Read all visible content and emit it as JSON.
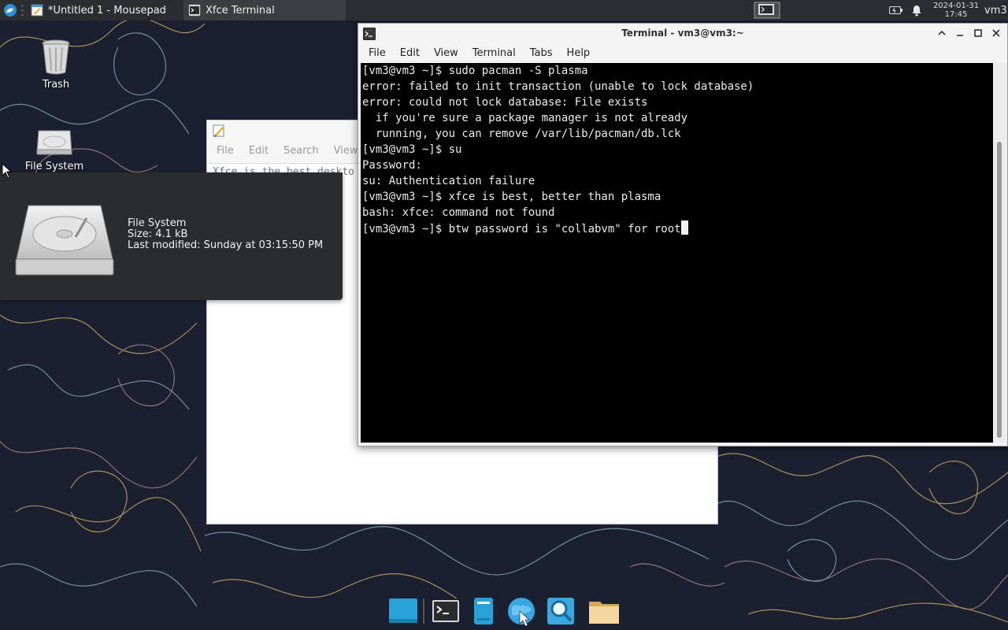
{
  "top_panel": {
    "tasks": [
      {
        "label": "*Untitled 1 - Mousepad",
        "active": false
      },
      {
        "label": "Xfce Terminal",
        "active": true
      }
    ],
    "clock": {
      "date": "2024-01-31",
      "time": "17:45"
    },
    "user": "vm3"
  },
  "desktop": {
    "icons": [
      {
        "label": "Trash"
      },
      {
        "label": "File System"
      }
    ]
  },
  "tooltip": {
    "name": "File System",
    "size": "Size: 4.1 kB",
    "modified": "Last modified: Sunday at 03:15:50 PM"
  },
  "mousepad": {
    "menu": [
      "File",
      "Edit",
      "Search",
      "View"
    ],
    "text": "Xfce is the best deskto"
  },
  "terminal": {
    "title": "Terminal - vm3@vm3:~",
    "menu": [
      "File",
      "Edit",
      "View",
      "Terminal",
      "Tabs",
      "Help"
    ],
    "lines": [
      "[vm3@vm3 ~]$ sudo pacman -S plasma",
      "error: failed to init transaction (unable to lock database)",
      "error: could not lock database: File exists",
      "  if you're sure a package manager is not already",
      "  running, you can remove /var/lib/pacman/db.lck",
      "[vm3@vm3 ~]$ su",
      "Password:",
      "su: Authentication failure",
      "[vm3@vm3 ~]$ xfce is best, better than plasma",
      "bash: xfce: command not found",
      "[vm3@vm3 ~]$ btw password is \"collabvm\" for root"
    ]
  },
  "dock": {
    "items": [
      {
        "icon": "show-desktop-icon"
      },
      {
        "icon": "terminal-icon"
      },
      {
        "icon": "mousepad-icon"
      },
      {
        "icon": "web-browser-icon"
      },
      {
        "icon": "app-finder-icon"
      },
      {
        "icon": "file-manager-icon"
      }
    ]
  },
  "colors": {
    "panel": "#2b2d30",
    "terminal_bg": "#000000",
    "wallpaper": "#1b2030"
  }
}
